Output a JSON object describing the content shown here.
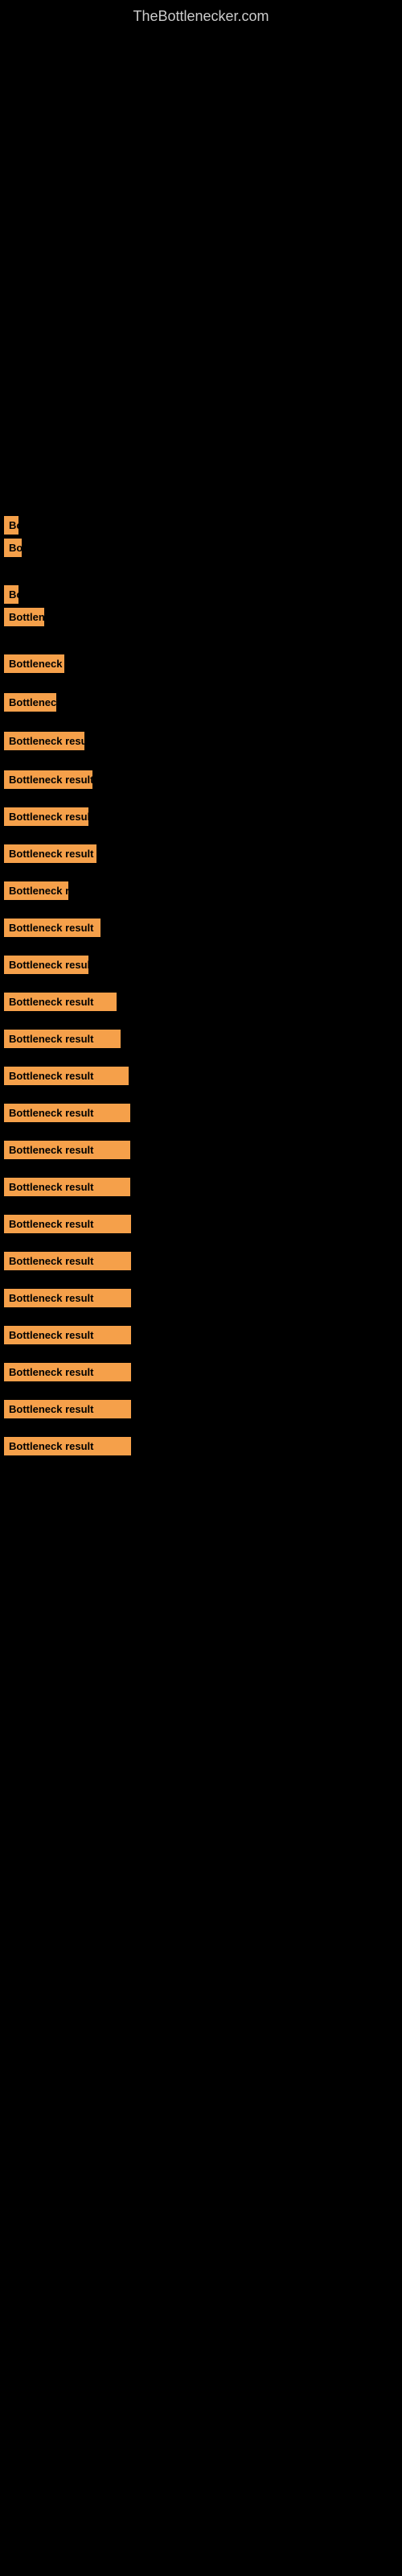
{
  "site": {
    "title": "TheBottlenecker.com"
  },
  "results": [
    {
      "id": 1,
      "label": "Bottleneck result",
      "width": 18
    },
    {
      "id": 2,
      "label": "Bottleneck result",
      "width": 22
    },
    {
      "id": 3,
      "label": "Bottleneck result",
      "width": 18
    },
    {
      "id": 4,
      "label": "Bottleneck result",
      "width": 50
    },
    {
      "id": 5,
      "label": "Bottleneck result",
      "width": 75
    },
    {
      "id": 6,
      "label": "Bottleneck result",
      "width": 65
    },
    {
      "id": 7,
      "label": "Bottleneck result",
      "width": 100
    },
    {
      "id": 8,
      "label": "Bottleneck result",
      "width": 110
    },
    {
      "id": 9,
      "label": "Bottleneck result",
      "width": 105
    },
    {
      "id": 10,
      "label": "Bottleneck result",
      "width": 115
    },
    {
      "id": 11,
      "label": "Bottleneck result",
      "width": 80
    },
    {
      "id": 12,
      "label": "Bottleneck result",
      "width": 120
    },
    {
      "id": 13,
      "label": "Bottleneck result",
      "width": 105
    },
    {
      "id": 14,
      "label": "Bottleneck result",
      "width": 140
    },
    {
      "id": 15,
      "label": "Bottleneck result",
      "width": 145
    },
    {
      "id": 16,
      "label": "Bottleneck result",
      "width": 155
    },
    {
      "id": 17,
      "label": "Bottleneck result",
      "width": 155
    },
    {
      "id": 18,
      "label": "Bottleneck result",
      "width": 155
    },
    {
      "id": 19,
      "label": "Bottleneck result",
      "width": 155
    },
    {
      "id": 20,
      "label": "Bottleneck result",
      "width": 155
    },
    {
      "id": 21,
      "label": "Bottleneck result",
      "width": 155
    },
    {
      "id": 22,
      "label": "Bottleneck result",
      "width": 155
    },
    {
      "id": 23,
      "label": "Bottleneck result",
      "width": 155
    },
    {
      "id": 24,
      "label": "Bottleneck result",
      "width": 155
    },
    {
      "id": 25,
      "label": "Bottleneck result",
      "width": 155
    },
    {
      "id": 26,
      "label": "Bottleneck result",
      "width": 155
    }
  ]
}
